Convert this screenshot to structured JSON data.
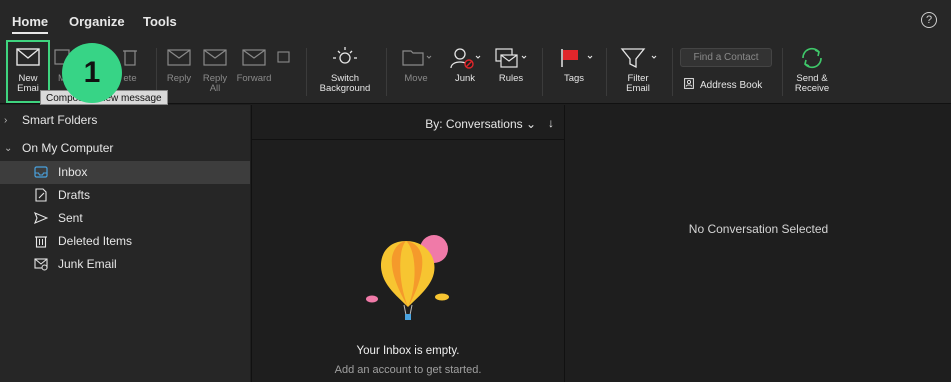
{
  "menu": {
    "tabs": [
      "Home",
      "Organize",
      "Tools"
    ],
    "help": "?"
  },
  "ribbon": {
    "new_email": [
      "New",
      "Emai"
    ],
    "reply": "Reply",
    "reply_all": [
      "Reply",
      "All"
    ],
    "forward": "Forward",
    "switch_background": [
      "Switch",
      "Background"
    ],
    "move": "Move",
    "junk": "Junk",
    "rules": "Rules",
    "tags": "Tags",
    "filter_email": [
      "Filter",
      "Email"
    ],
    "find_contact_placeholder": "Find a Contact",
    "address_book": "Address Book",
    "send_receive": [
      "Send &",
      "Receive"
    ],
    "hidden_partial": {
      "meeting_partial": "M",
      "delete_partial": "ete"
    }
  },
  "tooltip": {
    "text": "Compose a new message"
  },
  "step_badge": "1",
  "sidebar": {
    "groups": [
      {
        "label": "Smart Folders",
        "expanded": false
      },
      {
        "label": "On My Computer",
        "expanded": true
      }
    ],
    "folders": [
      {
        "label": "Inbox",
        "icon": "inbox-icon",
        "selected": true
      },
      {
        "label": "Drafts",
        "icon": "drafts-icon",
        "selected": false
      },
      {
        "label": "Sent",
        "icon": "sent-icon",
        "selected": false
      },
      {
        "label": "Deleted Items",
        "icon": "trash-icon",
        "selected": false
      },
      {
        "label": "Junk Email",
        "icon": "junk-folder-icon",
        "selected": false
      }
    ]
  },
  "message_list": {
    "sort_label": "By: Conversations ⌄",
    "sort_arrow": "↓",
    "empty_title": "Your Inbox is empty.",
    "empty_subtitle": "Add an account to get started."
  },
  "reading_pane": {
    "placeholder": "No Conversation Selected"
  },
  "colors": {
    "accent_green": "#37d486",
    "flag_red": "#e0262b",
    "balloon_yellow": "#f7c531",
    "balloon_pink": "#f07aa8",
    "send_green": "#3fc86a",
    "inbox_blue": "#4aa3e0"
  }
}
